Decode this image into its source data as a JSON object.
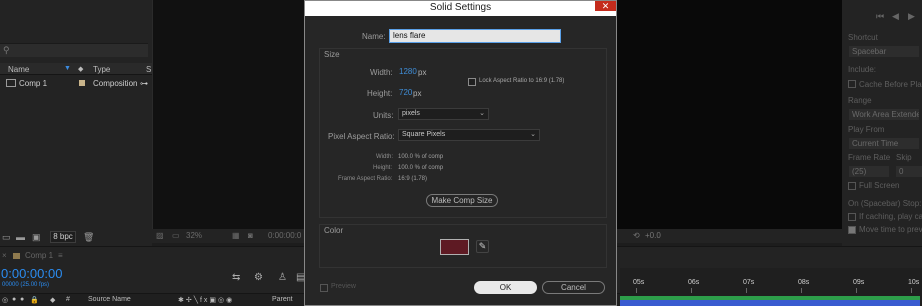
{
  "project": {
    "columns": {
      "name": "Name",
      "type": "Type",
      "size": "S"
    },
    "rows": [
      {
        "name": "Comp 1",
        "type": "Composition"
      }
    ],
    "bpc": "8 bpc"
  },
  "viewer": {
    "zoom": "32%",
    "timecode": "0:00:00:0",
    "exposure": "+0.0"
  },
  "preview_panel": {
    "shortcut_label": "Shortcut",
    "shortcut_value": "Spacebar",
    "include_label": "Include:",
    "cache_label": "Cache Before Play",
    "range_label": "Range",
    "range_value": "Work Area Extended",
    "play_from_label": "Play From",
    "play_from_value": "Current Time",
    "frame_rate_label": "Frame Rate",
    "skip_label": "Skip",
    "frame_rate_value": "(25)",
    "skip_value": "0",
    "full_screen_label": "Full Screen",
    "stop_label": "On (Spacebar) Stop:",
    "if_caching_label": "If caching, play cached",
    "move_time_label": "Move time to preview"
  },
  "timeline": {
    "tab": "Comp 1",
    "timecode": "0:00:00:00",
    "fps": "00000 (25.00 fps)",
    "source_name_header": "Source Name",
    "parent_header": "Parent",
    "ruler_ticks": [
      "05s",
      "06s",
      "07s",
      "08s",
      "09s",
      "10s"
    ]
  },
  "dialog": {
    "title": "Solid Settings",
    "name_label": "Name:",
    "name_value": "lens flare",
    "size_group_label": "Size",
    "width_label": "Width:",
    "width_value": "1280",
    "height_label": "Height:",
    "height_value": "720",
    "px": "px",
    "lock_aspect_label": "Lock Aspect Ratio to 16:9 (1.78)",
    "units_label": "Units:",
    "units_value": "pixels",
    "par_label": "Pixel Aspect Ratio:",
    "par_value": "Square Pixels",
    "info": [
      {
        "label": "Width:",
        "value": "100.0 % of comp"
      },
      {
        "label": "Height:",
        "value": "100.0 % of comp"
      },
      {
        "label": "Frame Aspect Ratio:",
        "value": "16:9 (1.78)"
      }
    ],
    "make_comp_size": "Make Comp Size",
    "color_group_label": "Color",
    "swatch_color": "#5e1a23",
    "preview_label": "Preview",
    "ok": "OK",
    "cancel": "Cancel"
  }
}
